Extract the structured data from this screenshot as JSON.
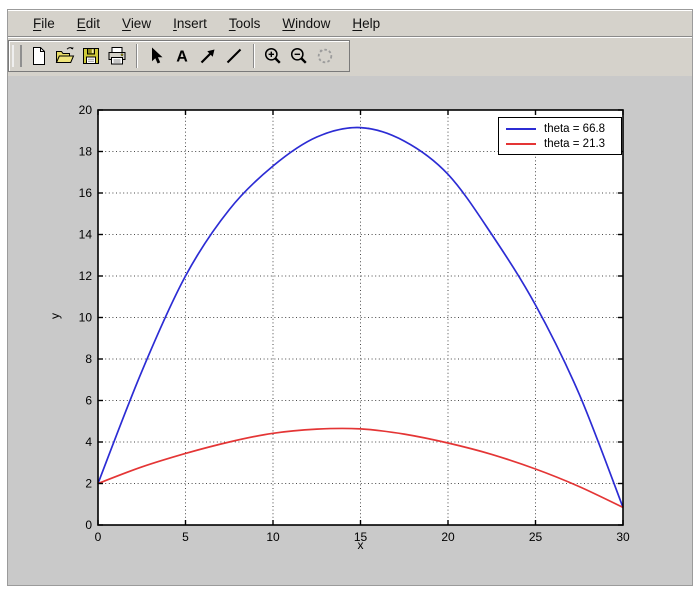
{
  "menubar": {
    "items": [
      {
        "label": "File"
      },
      {
        "label": "Edit"
      },
      {
        "label": "View"
      },
      {
        "label": "Insert"
      },
      {
        "label": "Tools"
      },
      {
        "label": "Window"
      },
      {
        "label": "Help"
      }
    ]
  },
  "toolbar": {
    "groups": [
      {
        "buttons": [
          {
            "name": "new-figure",
            "icon": "new-document"
          },
          {
            "name": "open-file",
            "icon": "open-folder"
          },
          {
            "name": "save-figure",
            "icon": "save"
          },
          {
            "name": "print-figure",
            "icon": "print"
          }
        ]
      },
      {
        "buttons": [
          {
            "name": "select-cursor",
            "icon": "arrow-cursor"
          },
          {
            "name": "add-text",
            "icon": "text"
          },
          {
            "name": "add-arrow",
            "icon": "ne-arrow"
          },
          {
            "name": "add-line",
            "icon": "line"
          }
        ]
      },
      {
        "buttons": [
          {
            "name": "zoom-in",
            "icon": "zoom-in"
          },
          {
            "name": "zoom-out",
            "icon": "zoom-out"
          },
          {
            "name": "rotate-3d",
            "icon": "rotate",
            "disabled": true
          }
        ]
      }
    ]
  },
  "chart_data": {
    "type": "line",
    "x": [
      0,
      2.5,
      5,
      7.5,
      10,
      12.5,
      15,
      17.5,
      20,
      22.5,
      25,
      27.5,
      30
    ],
    "series": [
      {
        "name": "theta = 66.8",
        "color": "#2c2cd4",
        "values": [
          2,
          7.4,
          12.0,
          15.2,
          17.3,
          18.7,
          19.15,
          18.5,
          16.9,
          14.0,
          10.6,
          6.3,
          0.85
        ]
      },
      {
        "name": "theta = 21.3",
        "color": "#e43535",
        "values": [
          2,
          2.8,
          3.45,
          4.0,
          4.42,
          4.62,
          4.63,
          4.38,
          3.95,
          3.4,
          2.7,
          1.85,
          0.85
        ]
      }
    ],
    "title": "",
    "xlabel": "x",
    "ylabel": "y",
    "xlim": [
      0,
      30
    ],
    "ylim": [
      0,
      20
    ],
    "xticks": [
      0,
      5,
      10,
      15,
      20,
      25,
      30
    ],
    "yticks": [
      0,
      2,
      4,
      6,
      8,
      10,
      12,
      14,
      16,
      18,
      20
    ],
    "grid": true,
    "legend_position": "top-right"
  }
}
